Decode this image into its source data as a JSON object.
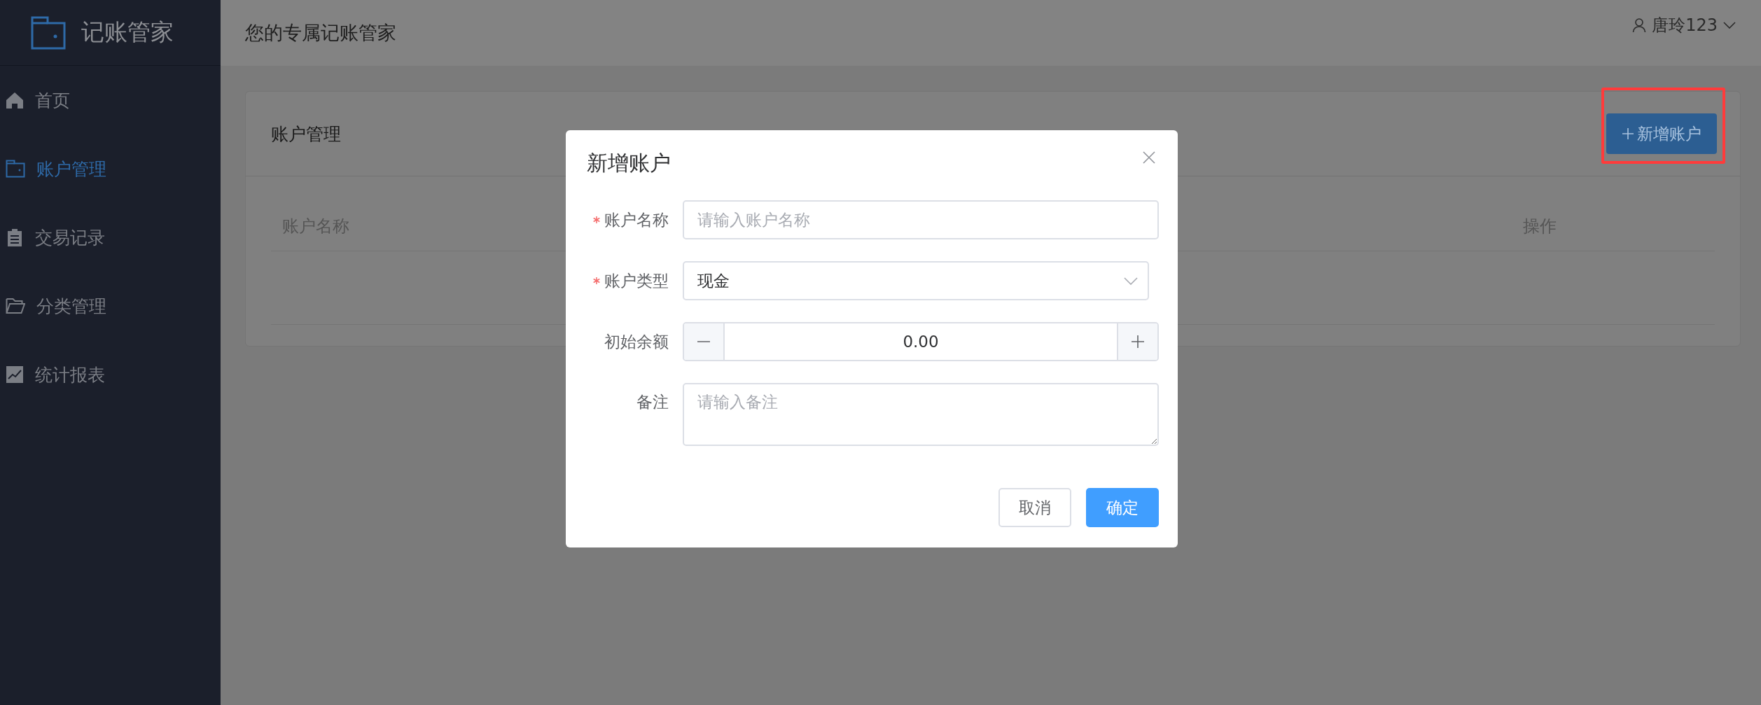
{
  "sidebar": {
    "logo": "记账管家",
    "items": [
      {
        "label": "首页",
        "kind": "home",
        "selected": false
      },
      {
        "label": "账户管理",
        "kind": "wallet",
        "selected": true
      },
      {
        "label": "交易记录",
        "kind": "clipboard",
        "selected": false
      },
      {
        "label": "分类管理",
        "kind": "folder",
        "selected": false
      },
      {
        "label": "统计报表",
        "kind": "chart",
        "selected": false
      }
    ]
  },
  "header": {
    "title": "您的专属记账管家",
    "user": "唐玲123"
  },
  "card": {
    "title": "账户管理",
    "add_button": {
      "label": "新增账户",
      "highlighted": true
    },
    "table": {
      "columns": [
        "账户名称",
        "操作"
      ]
    }
  },
  "dialog": {
    "title": "新增账户",
    "fields": [
      {
        "kind": "text",
        "label": "账户名称",
        "required": true,
        "placeholder": "请输入账户名称"
      },
      {
        "kind": "select",
        "label": "账户类型",
        "required": true,
        "value": "现金"
      },
      {
        "kind": "number",
        "label": "初始余额",
        "required": false,
        "value": "0.00"
      },
      {
        "kind": "textarea",
        "label": "备注",
        "required": false,
        "placeholder": "请输入备注"
      }
    ],
    "buttons": [
      {
        "label": "取消",
        "kind": "default"
      },
      {
        "label": "确定",
        "kind": "primary"
      }
    ]
  }
}
